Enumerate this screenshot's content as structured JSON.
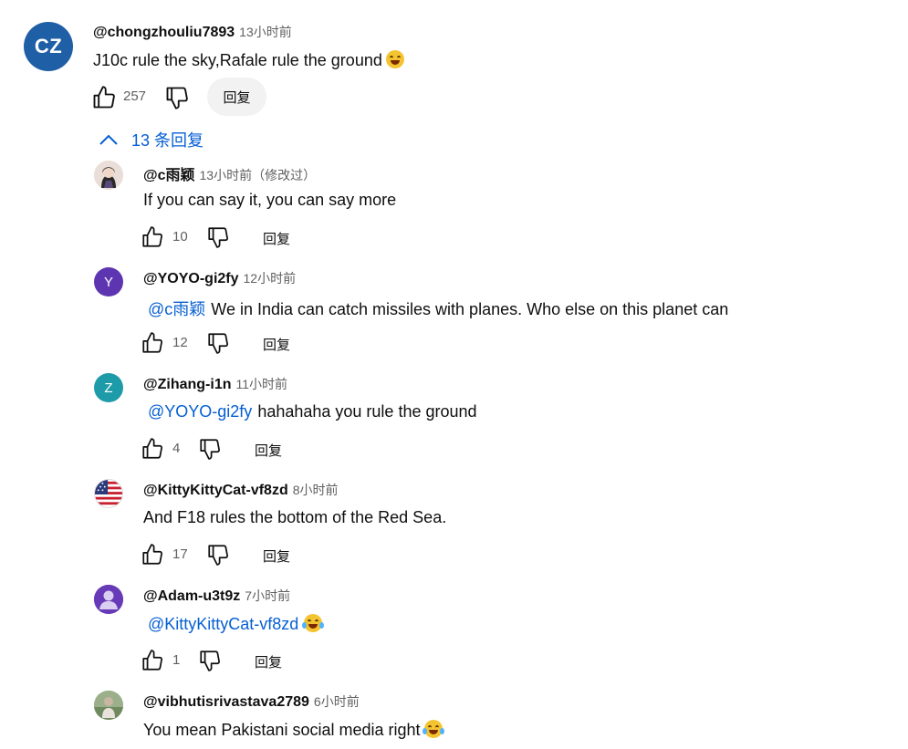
{
  "top_comment": {
    "avatar_initials": "CZ",
    "author": "@chongzhouliu7893",
    "time": "13小时前",
    "text": "J10c rule the sky,Rafale rule the ground",
    "likes": "257",
    "reply_label": "回复"
  },
  "replies_toggle": "13 条回复",
  "replies": [
    {
      "author": "@c雨颖",
      "time": "13小时前（修改过）",
      "mention": "",
      "text": "If you can say it, you can say more",
      "likes": "10",
      "reply_label": "回复",
      "avatar_letter": "",
      "avatar_color": "#d9c9c0"
    },
    {
      "author": "@YOYO-gi2fy",
      "time": "12小时前",
      "mention": "@c雨颖",
      "text": "We in India can catch missiles with planes. Who else on this planet can",
      "likes": "12",
      "reply_label": "回复",
      "avatar_letter": "Y",
      "avatar_color": "#5e35b1"
    },
    {
      "author": "@Zihang-i1n",
      "time": "11小时前",
      "mention": "@YOYO-gi2fy",
      "text": "hahahaha you rule the ground",
      "likes": "4",
      "reply_label": "回复",
      "avatar_letter": "Z",
      "avatar_color": "#1e9ba8"
    },
    {
      "author": "@KittyKittyCat-vf8zd",
      "time": "8小时前",
      "mention": "",
      "text": "And F18 rules the bottom of the Red Sea.",
      "likes": "17",
      "reply_label": "回复",
      "avatar_letter": "",
      "avatar_color": "#ffffff"
    },
    {
      "author": "@Adam-u3t9z",
      "time": "7小时前",
      "mention": "@KittyKittyCat-vf8zd",
      "text": "",
      "likes": "1",
      "reply_label": "回复",
      "avatar_letter": "",
      "avatar_color": "#673ab7"
    },
    {
      "author": "@vibhutisrivastava2789",
      "time": "6小时前",
      "mention": "",
      "text": "You mean Pakistani social media right",
      "likes": "",
      "reply_label": "",
      "avatar_letter": "",
      "avatar_color": "#8aa37a"
    }
  ]
}
